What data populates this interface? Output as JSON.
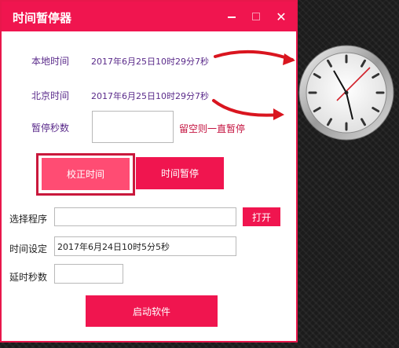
{
  "window": {
    "title": "时间暂停器"
  },
  "local_time": {
    "label": "本地时间",
    "value": "2017年6月25日10时29分7秒"
  },
  "beijing_time": {
    "label": "北京时间",
    "value": "2017年6月25日10时29分7秒"
  },
  "pause_seconds": {
    "label": "暂停秒数",
    "value": "",
    "hint": "留空则一直暂停"
  },
  "buttons": {
    "sync": "校正时间",
    "pause": "时间暂停",
    "open": "打开",
    "launch": "启动软件"
  },
  "select_program": {
    "label": "选择程序",
    "value": ""
  },
  "time_setting": {
    "label": "时间设定",
    "value": "2017年6月24日10时5分5秒"
  },
  "delay_seconds": {
    "label": "延时秒数",
    "value": ""
  },
  "colors": {
    "accent": "#f0154f",
    "highlight_border": "#c9183c"
  }
}
